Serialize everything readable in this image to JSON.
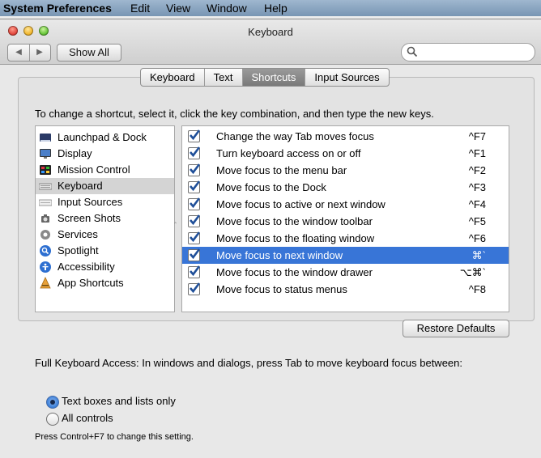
{
  "menubar": {
    "app": "System Preferences",
    "items": [
      "Edit",
      "View",
      "Window",
      "Help"
    ]
  },
  "window": {
    "title": "Keyboard",
    "show_all": "Show All",
    "search_placeholder": ""
  },
  "tabs": [
    {
      "label": "Keyboard",
      "active": false
    },
    {
      "label": "Text",
      "active": false
    },
    {
      "label": "Shortcuts",
      "active": true
    },
    {
      "label": "Input Sources",
      "active": false
    }
  ],
  "instruction": "To change a shortcut, select it, click the key combination, and then type the new keys.",
  "categories": [
    {
      "label": "Launchpad & Dock",
      "icon": "launchpad-dock-icon"
    },
    {
      "label": "Display",
      "icon": "display-icon"
    },
    {
      "label": "Mission Control",
      "icon": "mission-control-icon"
    },
    {
      "label": "Keyboard",
      "icon": "keyboard-icon",
      "selected": true
    },
    {
      "label": "Input Sources",
      "icon": "input-sources-icon"
    },
    {
      "label": "Screen Shots",
      "icon": "screen-shots-icon"
    },
    {
      "label": "Services",
      "icon": "services-gear-icon"
    },
    {
      "label": "Spotlight",
      "icon": "spotlight-icon"
    },
    {
      "label": "Accessibility",
      "icon": "accessibility-icon"
    },
    {
      "label": "App Shortcuts",
      "icon": "app-shortcuts-icon"
    }
  ],
  "shortcuts": [
    {
      "label": "Change the way Tab moves focus",
      "key": "^F7",
      "checked": true
    },
    {
      "label": "Turn keyboard access on or off",
      "key": "^F1",
      "checked": true
    },
    {
      "label": "Move focus to the menu bar",
      "key": "^F2",
      "checked": true
    },
    {
      "label": "Move focus to the Dock",
      "key": "^F3",
      "checked": true
    },
    {
      "label": "Move focus to active or next window",
      "key": "^F4",
      "checked": true
    },
    {
      "label": "Move focus to the window toolbar",
      "key": "^F5",
      "checked": true
    },
    {
      "label": "Move focus to the floating window",
      "key": "^F6",
      "checked": true
    },
    {
      "label": "Move focus to next window",
      "key": "⌘`",
      "checked": true,
      "selected": true
    },
    {
      "label": "Move focus to the window drawer",
      "key": "⌥⌘`",
      "checked": true
    },
    {
      "label": "Move focus to status menus",
      "key": "^F8",
      "checked": true
    }
  ],
  "restore_defaults": "Restore Defaults",
  "full_keyboard_access": {
    "label": "Full Keyboard Access: In windows and dialogs, press Tab to move keyboard focus between:",
    "options": [
      {
        "label": "Text boxes and lists only",
        "selected": true
      },
      {
        "label": "All controls",
        "selected": false
      }
    ],
    "hint": "Press Control+F7 to change this setting."
  },
  "colors": {
    "selection": "#3875d7",
    "checkbox": "#1f4f99"
  }
}
